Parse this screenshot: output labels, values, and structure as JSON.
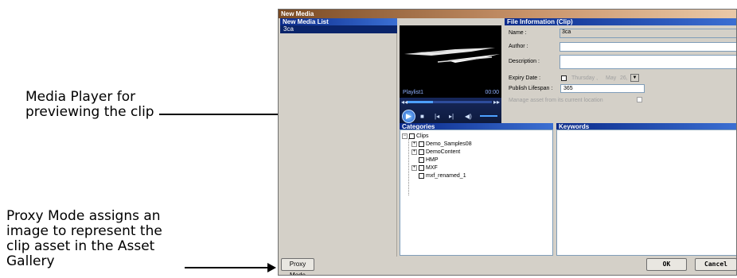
{
  "callouts": {
    "player_note": "Media Player for previewing the clip",
    "proxy_note": "Proxy Mode assigns an image to represent the clip asset in the Asset Gallery"
  },
  "dialog": {
    "title": "New Media",
    "media_list": {
      "header": "New Media List",
      "items": [
        "3ca"
      ]
    },
    "player": {
      "playlist_label": "Playlist1",
      "timecode": "00:00"
    },
    "file_info": {
      "header": "File Information (Clip)",
      "name_label": "Name :",
      "name_value": "3ca",
      "author_label": "Author :",
      "author_value": "",
      "description_label": "Description :",
      "description_value": "",
      "expiry_label": "Expiry Date :",
      "expiry_day": "Thursday ,",
      "expiry_month": "May",
      "expiry_date": "26,",
      "lifespan_label": "Publish Lifespan :",
      "lifespan_value": "365",
      "manage_label": "Manage asset from its current location"
    },
    "categories": {
      "header": "Categories",
      "root": "Clips",
      "children": [
        "Demo_Samples08",
        "DemoContent",
        "HMP",
        "MXF",
        "mxf_renamed_1"
      ]
    },
    "keywords": {
      "header": "Keywords"
    },
    "buttons": {
      "proxy": "Proxy Mode",
      "ok": "OK",
      "cancel": "Cancel"
    }
  }
}
